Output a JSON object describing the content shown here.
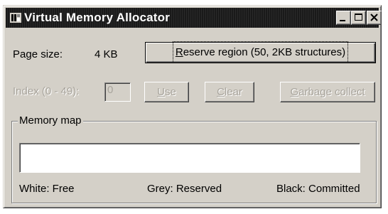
{
  "window": {
    "title": "Virtual Memory Allocator",
    "titlebar_buttons": [
      "minimize-icon",
      "maximize-icon",
      "close-icon"
    ]
  },
  "page_size": {
    "label": "Page size:",
    "value": "4 KB"
  },
  "buttons": {
    "reserve": {
      "hotkey": "R",
      "rest": "eserve region (50, 2KB structures)"
    },
    "use": {
      "hotkey": "U",
      "rest": "se"
    },
    "clear": {
      "hotkey": "C",
      "rest": "lear"
    },
    "gc": {
      "hotkey": "G",
      "rest": "arbage collect"
    }
  },
  "index": {
    "label": "Index (0 - 49):",
    "value": "0"
  },
  "memory_map": {
    "legend": "Memory map",
    "key_free": "White: Free",
    "key_reserved": "Grey: Reserved",
    "key_committed": "Black: Committed"
  },
  "colors": {
    "face": "#d4d0c8",
    "titlebar": "#1a1a1a",
    "disabled_text": "#a8a49c"
  }
}
